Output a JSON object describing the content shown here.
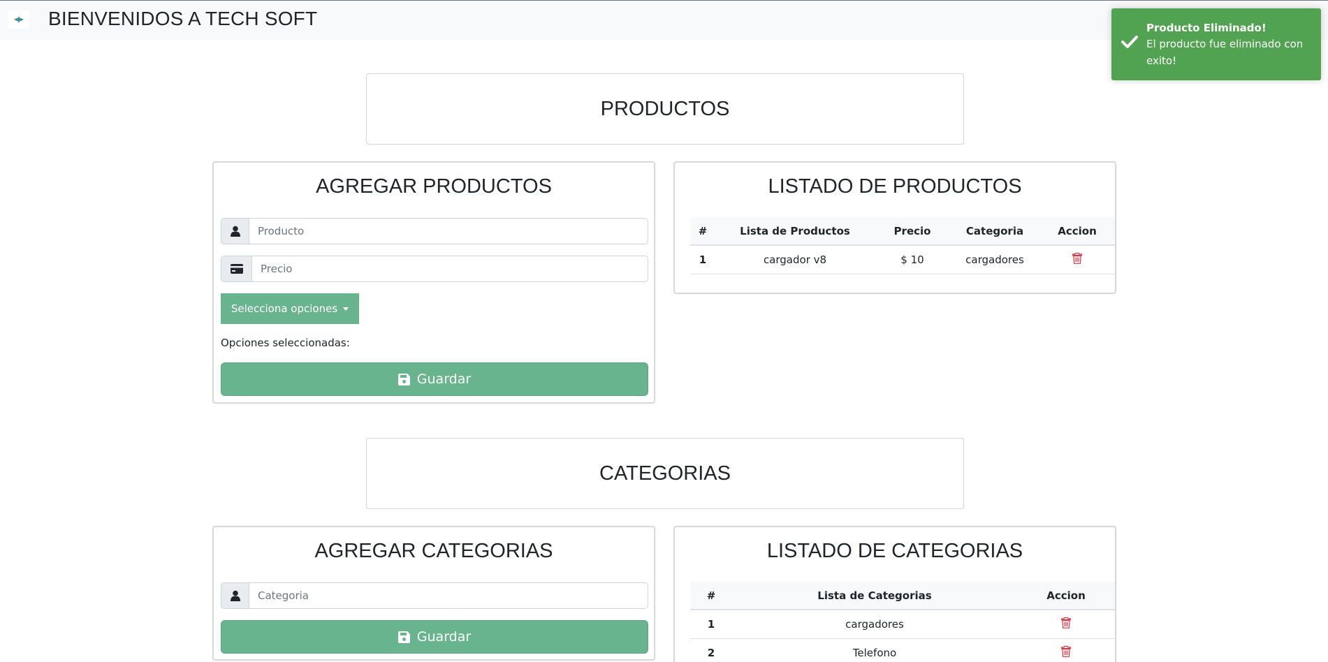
{
  "navbar": {
    "title": "BIENVENIDOS A TECH SOFT",
    "logo_icon": "sparkle-logo-icon"
  },
  "productos": {
    "section_title": "PRODUCTOS",
    "form": {
      "title": "AGREGAR PRODUCTOS",
      "product_placeholder": "Producto",
      "price_placeholder": "Precio",
      "dropdown_label": "Selecciona opciones",
      "selected_label": "Opciones seleccionadas:",
      "save_label": "Guardar"
    },
    "list": {
      "title": "LISTADO DE PRODUCTOS",
      "columns": [
        "#",
        "Lista de Productos",
        "Precio",
        "Categoria",
        "Accion"
      ],
      "rows": [
        {
          "num": "1",
          "name": "cargador v8",
          "price": "$ 10",
          "category": "cargadores"
        }
      ]
    }
  },
  "categorias": {
    "section_title": "CATEGORIAS",
    "form": {
      "title": "AGREGAR CATEGORIAS",
      "category_placeholder": "Categoria",
      "save_label": "Guardar"
    },
    "list": {
      "title": "LISTADO DE CATEGORIAS",
      "columns": [
        "#",
        "Lista de Categorias",
        "Accion"
      ],
      "rows": [
        {
          "num": "1",
          "name": "cargadores"
        },
        {
          "num": "2",
          "name": "Telefono"
        }
      ]
    }
  },
  "toast": {
    "title": "Producto Eliminado!",
    "message": "El producto fue eliminado con exito!",
    "color": "#51a351"
  },
  "colors": {
    "primary_button": "#67b48f",
    "danger_icon": "#dc3545"
  }
}
